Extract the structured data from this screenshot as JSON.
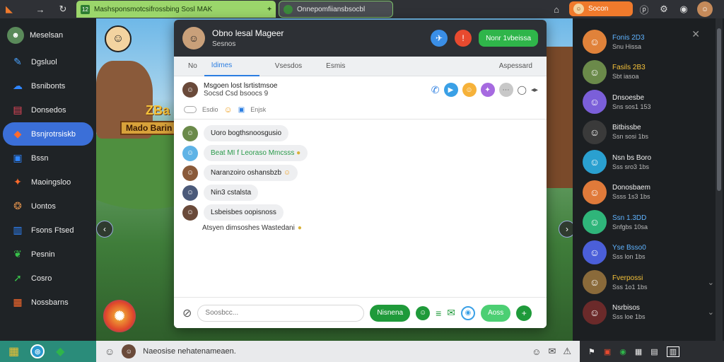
{
  "browser": {
    "tab1_title": "Mashsponsmotcsifrossbing Sosl MAK",
    "tab2_title": "Onnepomfiiansbsocbl",
    "user_pill": "Socon"
  },
  "left_sidebar": {
    "header": "Meselsan",
    "items": [
      {
        "label": "Dgsluol",
        "icon": "pen-icon",
        "color": "#4aa3ff"
      },
      {
        "label": "Bsnibonts",
        "icon": "cloud-icon",
        "color": "#2f86ff"
      },
      {
        "label": "Donsedos",
        "icon": "chat-icon",
        "color": "#e8485a"
      },
      {
        "label": "Bsnjrotrsiskb",
        "icon": "gamepad-icon",
        "color": "#ffffff",
        "active": true
      },
      {
        "label": "Bssn",
        "icon": "image-icon",
        "color": "#2f86ff"
      },
      {
        "label": "Maoingsloo",
        "icon": "controller-icon",
        "color": "#ff6b2c"
      },
      {
        "label": "Uontos",
        "icon": "bear-icon",
        "color": "#d28a4a"
      },
      {
        "label": "Fsons Ftsed",
        "icon": "book-icon",
        "color": "#2f86ff"
      },
      {
        "label": "Pesnin",
        "icon": "leaf-icon",
        "color": "#38c34a"
      },
      {
        "label": "Cosro",
        "icon": "run-icon",
        "color": "#38c34a"
      },
      {
        "label": "Nossbarns",
        "icon": "grid-icon",
        "color": "#ff6b2c"
      }
    ]
  },
  "game": {
    "sign_text": "Mado  Barin",
    "top_text": "ZBa"
  },
  "chat": {
    "title": "Obno lesal Mageer",
    "subtitle": "Sesnos",
    "join_button": "Nonr 1vbeissa",
    "tabs": [
      "No",
      "Idimes",
      "Vsesdos",
      "Esmis",
      "Aspessard"
    ],
    "selected_tab": 1,
    "conversation": {
      "line1": "Msgoen lost lsrtistmsoe",
      "line2": "Socsd Csd bsoocs 9",
      "meta_left": "Esdio",
      "meta_right": "Enjsk"
    },
    "messages": [
      {
        "text": "Uoro bogthsnoosgusio",
        "avatar_color": "#6b8a4a",
        "badge_color": "#2fb54a"
      },
      {
        "text": "Beat MI f Leoraso Mmcsss",
        "avatar_color": "#5fb3e6",
        "badge_color": "#2fb54a"
      },
      {
        "text": "Naranzoiro oshansbzb",
        "avatar_color": "#8a5a3a",
        "badge_color": "#f28c28"
      },
      {
        "text": "Nin3 cstalsta",
        "avatar_color": "#4b5a7a",
        "badge_color": "#2fb54a"
      },
      {
        "text": "Lsbeisbes oopisnoss",
        "avatar_color": "#6a4a3a",
        "badge_color": "#2fb54a"
      }
    ],
    "system_line": "Atsyen dimsoshes Wastedani",
    "composer": {
      "placeholder": "Soosbcc...",
      "send_label": "Nisnena",
      "action_label": "Aoss"
    }
  },
  "contacts": [
    {
      "name": "Fonis 2D3",
      "status": "Snu Hissa",
      "avatar": "#e0823a",
      "name_color": "#5fb3ff"
    },
    {
      "name": "Fasils 2B3",
      "status": "Sbt iasoa",
      "avatar": "#6b8a4a",
      "name_color": "#f5c23a"
    },
    {
      "name": "Dnsoesbe",
      "status": "Sns sos1 153",
      "avatar": "#7b5fd9",
      "name_color": "#f2f2f2"
    },
    {
      "name": "Bitbissbe",
      "status": "Ssn sosi 1bs",
      "avatar": "#3a3a3a",
      "name_color": "#f2f2f2"
    },
    {
      "name": "Nsn bs Boro",
      "status": "Sss sro3 1bs",
      "avatar": "#2aa0d0",
      "name_color": "#f2f2f2"
    },
    {
      "name": "Donosbaem",
      "status": "Ssss 1s3 1bs",
      "avatar": "#e07a3a",
      "name_color": "#f2f2f2"
    },
    {
      "name": "Ssn 1.3DD",
      "status": "Snfgbs 10sa",
      "avatar": "#2fb57a",
      "name_color": "#5fb3ff"
    },
    {
      "name": "Yse Bsso0",
      "status": "Sss lon 1bs",
      "avatar": "#4b5fd9",
      "name_color": "#5fb3ff"
    },
    {
      "name": "Fverpossi",
      "status": "Sss 1o1 1bs",
      "avatar": "#8a6a3a",
      "name_color": "#f5c23a"
    },
    {
      "name": "Nsrbisos",
      "status": "Sss loe 1bs",
      "avatar": "#6b2a2a",
      "name_color": "#f2f2f2"
    }
  ],
  "taskbar": {
    "status_text": "Naeosise nehatenameaen."
  }
}
